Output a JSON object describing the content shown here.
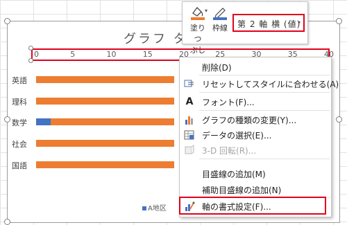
{
  "chart": {
    "title": "グラフ タ",
    "x_ticks": [
      "0",
      "5",
      "10",
      "15",
      "20",
      "25",
      "30",
      "35",
      "40"
    ],
    "categories": [
      "英語",
      "理科",
      "数学",
      "社会",
      "国語"
    ],
    "legend_label": "A地区"
  },
  "chart_data": {
    "type": "bar",
    "title": "グラフ タ",
    "categories": [
      "英語",
      "理科",
      "数学",
      "社会",
      "国語"
    ],
    "series": [
      {
        "name": "A地区",
        "color": "#4472c4",
        "values": [
          0,
          0,
          2,
          0,
          0
        ]
      },
      {
        "name": "",
        "color": "#ed7d31",
        "values": [
          19,
          19,
          17,
          19,
          19
        ]
      }
    ],
    "xlim": [
      0,
      40
    ],
    "orientation": "horizontal",
    "grid": false,
    "legend_position": "bottom"
  },
  "ribbon": {
    "fill_label_line1": "塗りつ",
    "fill_label_line2": "ぶし",
    "outline_label": "枠線",
    "element_selector": "第 2 軸 横 (値)",
    "element_caret": "▾",
    "fill_caret": "▾",
    "fill_icon": "paint-bucket-icon",
    "outline_icon": "pen-icon",
    "fill_color": "#ed7d31",
    "outline_color": "#4472c4"
  },
  "context_menu": {
    "items": [
      {
        "label": "削除(D)",
        "icon": "",
        "disabled": false
      },
      {
        "label": "リセットしてスタイルに合わせる(A)",
        "icon": "reset-style-icon",
        "disabled": false
      },
      {
        "label": "フォント(F)...",
        "icon": "font-icon",
        "disabled": false
      },
      {
        "label": "グラフの種類の変更(Y)...",
        "icon": "chart-type-icon",
        "disabled": false
      },
      {
        "label": "データの選択(E)...",
        "icon": "select-data-icon",
        "disabled": false
      },
      {
        "label": "3-D 回転(R)...",
        "icon": "3d-rotation-icon",
        "disabled": true
      },
      {
        "label": "目盛線の追加(M)",
        "icon": "",
        "disabled": false
      },
      {
        "label": "補助目盛線の追加(N)",
        "icon": "",
        "disabled": false
      },
      {
        "label": "軸の書式設定(F)...",
        "icon": "format-axis-icon",
        "disabled": false
      }
    ]
  }
}
